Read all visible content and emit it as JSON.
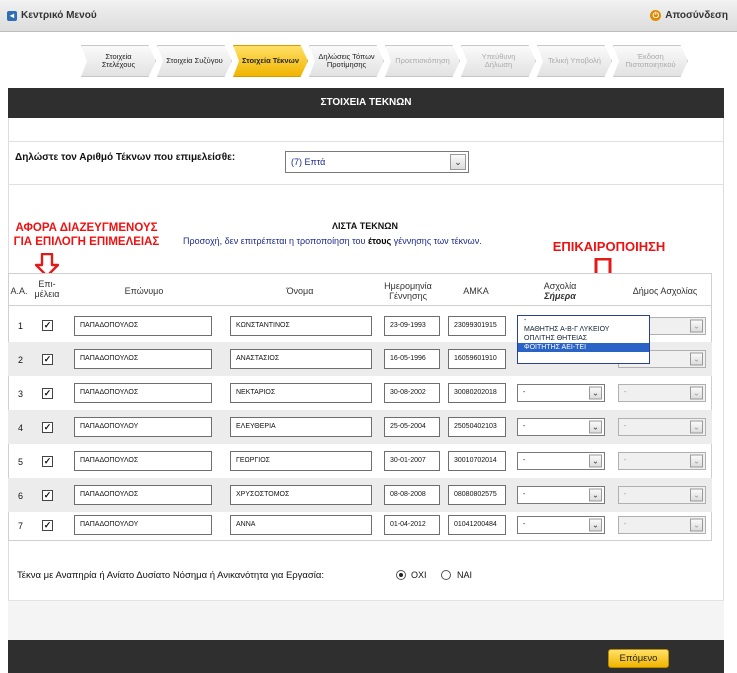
{
  "topbar": {
    "home_label": "Κεντρικό Μενού",
    "logout_label": "Αποσύνδεση"
  },
  "steps": [
    {
      "label": "Στοιχεία Στελέχους",
      "state": "done"
    },
    {
      "label": "Στοιχεία Συζύγου",
      "state": "done"
    },
    {
      "label": "Στοιχεία Τέκνων",
      "state": "active"
    },
    {
      "label": "Δηλώσεις Τόπων Προτίμησης",
      "state": "todo"
    },
    {
      "label": "Προεπισκόπηση",
      "state": "disabled"
    },
    {
      "label": "Υπεύθυνη Δήλωση",
      "state": "disabled"
    },
    {
      "label": "Τελική Υποβολή",
      "state": "disabled"
    },
    {
      "label": "Έκδοση Πιστοποιητικού",
      "state": "disabled"
    }
  ],
  "section_title": "ΣΤΟΙΧΕΙΑ ΤΕΚΝΩΝ",
  "children_count": {
    "label": "Δηλώστε τον Αριθμό Τέκνων που επιμελείσθε:",
    "value": "(7) Επτά"
  },
  "annotations": {
    "divorced_note_line1": "ΑΦΟΡΑ ΔΙΑΖΕΥΓΜΕΝΟΥΣ",
    "divorced_note_line2": "ΓΙΑ ΕΠΙΛΟΓΗ ΕΠΙΜΕΛΕΙΑΣ",
    "update_note": "ΕΠΙΚΑΙΡΟΠΟΙΗΣΗ",
    "arrow_color": "#e11a1a"
  },
  "list": {
    "title": "ΛΙΣΤΑ ΤΕΚΝΩΝ",
    "note_before": "Προσοχή, δεν επιτρέπεται η τροποποίηση του ",
    "note_bold": "έτους",
    "note_after": " γέννησης των τέκνων."
  },
  "columns": {
    "aa": "Α.Α.",
    "custody_1": "Επι-",
    "custody_2": "μέλεια",
    "surname": "Επώνυμο",
    "name": "Όνομα",
    "birth_1": "Ημερομηνία",
    "birth_2": "Γέννησης",
    "amka": "ΑΜΚΑ",
    "occupation_1": "Ασχολία",
    "occupation_2": "Σήμερα",
    "municipality": "Δήμος Ασχολίας"
  },
  "rows": [
    {
      "aa": "1",
      "custody": true,
      "surname": "ΠΑΠΑΔΟΠΟΥΛΟΣ",
      "name": "ΚΩΝΣΤΑΝΤΙΝΟΣ",
      "birth": "23-09-1993",
      "amka": "23099301915",
      "occupation": "-",
      "municipality": ""
    },
    {
      "aa": "2",
      "custody": true,
      "surname": "ΠΑΠΑΔΟΠΟΥΛΟΣ",
      "name": "ΑΝΑΣΤΑΣΙΟΣ",
      "birth": "16-05-1996",
      "amka": "16059601910",
      "occupation": "-",
      "municipality": ""
    },
    {
      "aa": "3",
      "custody": true,
      "surname": "ΠΑΠΑΔΟΠΟΥΛΟΣ",
      "name": "ΝΕΚΤΑΡΙΟΣ",
      "birth": "30-08-2002",
      "amka": "30080202018",
      "occupation": "-",
      "municipality": "-"
    },
    {
      "aa": "4",
      "custody": true,
      "surname": "ΠΑΠΑΔΟΠΟΥΛΟΥ",
      "name": "ΕΛΕΥΘΕΡΙΑ",
      "birth": "25-05-2004",
      "amka": "25050402103",
      "occupation": "-",
      "municipality": "-"
    },
    {
      "aa": "5",
      "custody": true,
      "surname": "ΠΑΠΑΔΟΠΟΥΛΟΣ",
      "name": "ΓΕΩΡΓΙΟΣ",
      "birth": "30-01-2007",
      "amka": "30010702014",
      "occupation": "-",
      "municipality": "-"
    },
    {
      "aa": "6",
      "custody": true,
      "surname": "ΠΑΠΑΔΟΠΟΥΛΟΣ",
      "name": "ΧΡΥΣΟΣΤΟΜΟΣ",
      "birth": "08-08-2008",
      "amka": "08080802575",
      "occupation": "-",
      "municipality": "-"
    },
    {
      "aa": "7",
      "custody": true,
      "surname": "ΠΑΠΑΔΟΠΟΥΛΟΥ",
      "name": "ΑΝΝΑ",
      "birth": "01-04-2012",
      "amka": "01041200484",
      "occupation": "-",
      "municipality": "-"
    }
  ],
  "occupation_dropdown": {
    "options": [
      "-",
      "ΜΑΘΗΤΗΣ Α-Β-Γ ΛΥΚΕΙΟΥ",
      "ΟΠΛΙΤΗΣ ΘΗΤΕΙΑΣ",
      "ΦΟΙΤΗΤΗΣ ΑΕΙ-ΤΕΙ"
    ],
    "highlighted": "ΦΟΙΤΗΤΗΣ ΑΕΙ-ΤΕΙ"
  },
  "disability": {
    "label": "Τέκνα με Αναπηρία ή Ανίατο Δυσίατο Νόσημα ή Ανικανότητα για Εργασία:",
    "option_no": "ΟΧΙ",
    "option_yes": "ΝΑΙ",
    "selected": "ΟΧΙ"
  },
  "next_label": "Επόμενο"
}
